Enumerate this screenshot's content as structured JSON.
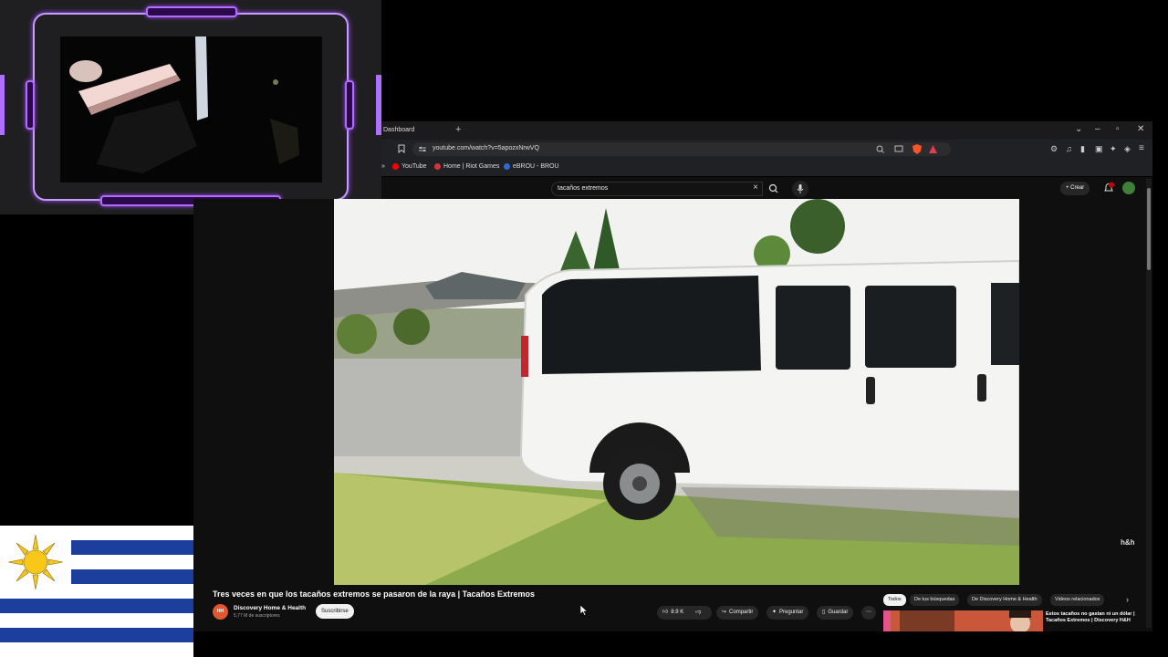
{
  "browser": {
    "tab_label": "Dashboard",
    "url": "youtube.com/watch?v=5apozxNrwVQ",
    "bookmarks": [
      {
        "label": "YouTube",
        "color": "#ff0000"
      },
      {
        "label": "Home | Riot Games",
        "color": "#d13639"
      },
      {
        "label": "eBROU - BROU",
        "color": "#2f6ad0"
      }
    ]
  },
  "youtube": {
    "search_value": "tacaños extremos",
    "create_label": "Crear",
    "notif_count": "9+",
    "watermark": "h&h",
    "video_title": "Tres veces en que los tacaños extremos se pasaron de la raya | Tacaños Extremos",
    "channel_initials": "HH",
    "channel_name": "Discovery Home & Health",
    "subscribers": "5,77 M de suscriptores",
    "subscribe_label": "Suscribirse",
    "like_count": "8.9 K",
    "share_label": "Compartir",
    "ask_label": "Preguntar",
    "save_label": "Guardar",
    "chips": [
      "Todos",
      "De tus búsquedas",
      "De Discovery Home & Health",
      "Videos relacionados"
    ],
    "recommended_title": "Estos tacaños no gastan ni un dólar | Tacaños Extremos | Discovery H&H"
  },
  "colors": {
    "neon_purple": "#b56bff",
    "flag_blue": "#1c3e9c",
    "flag_sun": "#f7c71a",
    "yt_red": "#ff0000"
  }
}
